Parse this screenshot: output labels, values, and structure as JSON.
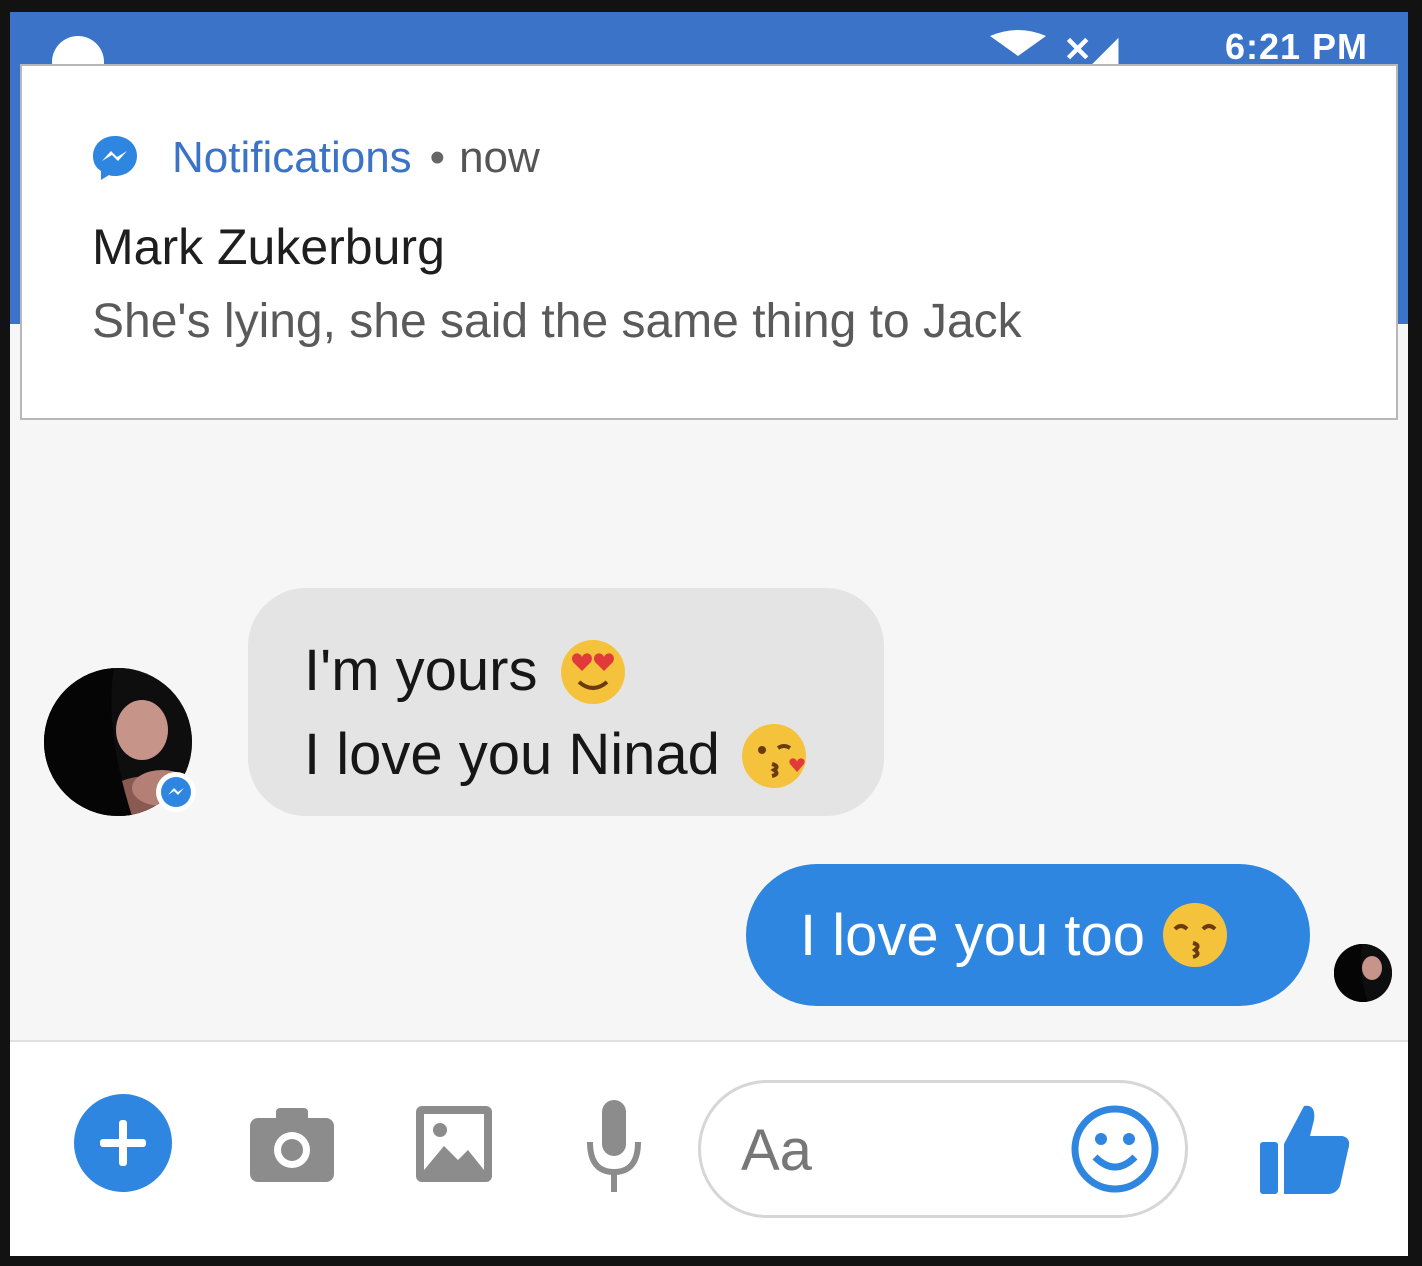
{
  "status_bar": {
    "clock": "6:21 PM",
    "signal_text": "✕◢"
  },
  "notification": {
    "app_name": "Notifications",
    "separator": "•",
    "time": "now",
    "title": "Mark Zukerburg",
    "body": "She's lying, she said the same thing to Jack",
    "app_icon": "messenger-icon"
  },
  "conversation": {
    "incoming": {
      "lines": [
        {
          "text": "I'm yours",
          "emoji": "heart-eyes-emoji"
        },
        {
          "text": "I love you Ninad",
          "emoji": "kissing-heart-emoji"
        }
      ],
      "avatar": "contact-avatar"
    },
    "outgoing": {
      "text": "I love you too",
      "emoji": "kissing-closed-eyes-emoji",
      "avatar": "seen-avatar"
    }
  },
  "composer": {
    "placeholder": "Aa",
    "value": "",
    "icons": [
      "plus-icon",
      "camera-icon",
      "gallery-icon",
      "microphone-icon",
      "smiley-icon",
      "thumbs-up-icon"
    ]
  },
  "colors": {
    "brand_blue": "#2e86e0",
    "status_bar": "#3a73c8",
    "incoming_bubble": "#e4e4e4",
    "background": "#f6f6f6"
  }
}
